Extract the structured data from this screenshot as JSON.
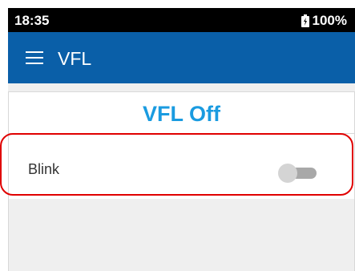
{
  "status_bar": {
    "time": "18:35",
    "battery": "100%",
    "battery_icon": "battery-charging-icon"
  },
  "app_bar": {
    "menu_icon": "hamburger-menu-icon",
    "title": "VFL"
  },
  "vfl": {
    "status": "VFL Off",
    "status_color": "#1a9be0"
  },
  "blink": {
    "label": "Blink",
    "enabled": false
  },
  "colors": {
    "app_bar": "#0a5fa8",
    "highlight": "#e00000"
  }
}
